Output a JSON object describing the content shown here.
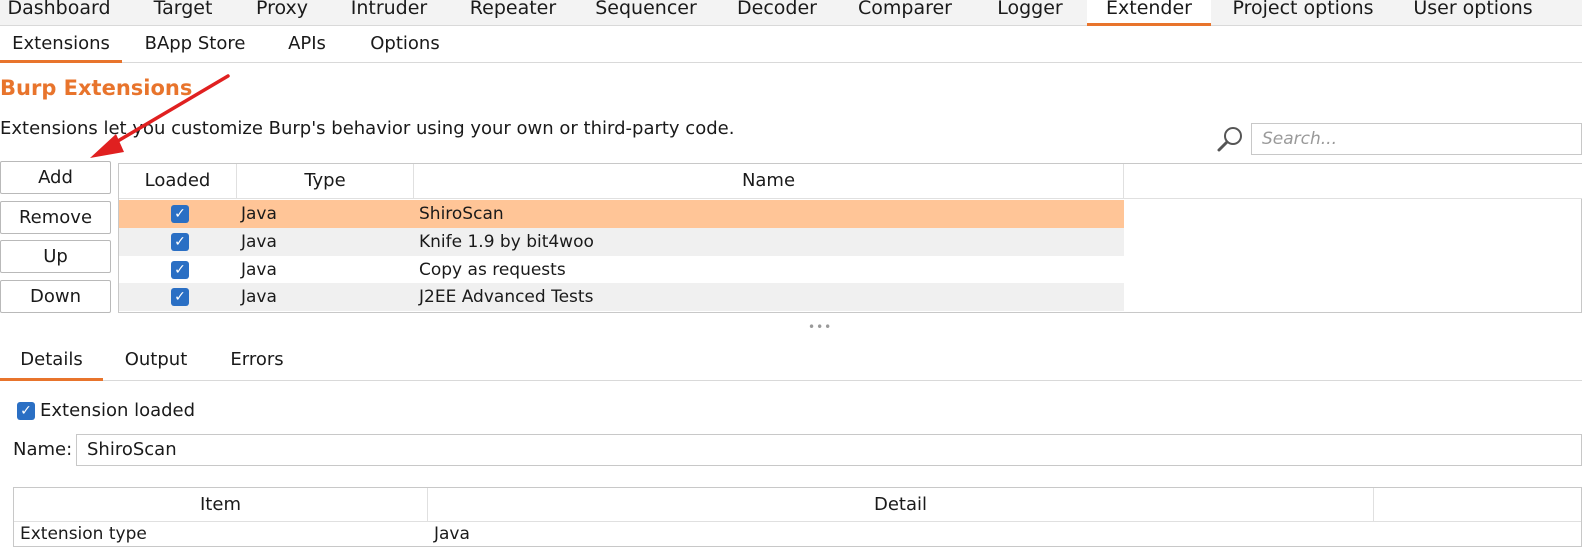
{
  "top_tabs": [
    "Dashboard",
    "Target",
    "Proxy",
    "Intruder",
    "Repeater",
    "Sequencer",
    "Decoder",
    "Comparer",
    "Logger",
    "Extender",
    "Project options",
    "User options"
  ],
  "top_tabs_active": "Extender",
  "sub_tabs": [
    "Extensions",
    "BApp Store",
    "APIs",
    "Options"
  ],
  "sub_tabs_active": "Extensions",
  "section": {
    "title": "Burp Extensions",
    "description": "Extensions let you customize Burp's behavior using your own or third-party code."
  },
  "search": {
    "placeholder": "Search...",
    "icon": "magnifier-icon"
  },
  "buttons": {
    "add": "Add",
    "remove": "Remove",
    "up": "Up",
    "down": "Down"
  },
  "extensions_table": {
    "columns": [
      "Loaded",
      "Type",
      "Name"
    ],
    "rows": [
      {
        "loaded": true,
        "type": "Java",
        "name": "ShiroScan",
        "selected": true
      },
      {
        "loaded": true,
        "type": "Java",
        "name": "Knife 1.9 by bit4woo",
        "selected": false
      },
      {
        "loaded": true,
        "type": "Java",
        "name": "Copy as requests",
        "selected": false
      },
      {
        "loaded": true,
        "type": "Java",
        "name": "J2EE Advanced Tests",
        "selected": false
      }
    ]
  },
  "lower_tabs": [
    "Details",
    "Output",
    "Errors"
  ],
  "lower_tabs_active": "Details",
  "details": {
    "extension_loaded_label": "Extension loaded",
    "extension_loaded": true,
    "name_label": "Name:",
    "name_value": "ShiroScan",
    "table_columns": [
      "Item",
      "Detail"
    ],
    "first_row": {
      "item": "Extension type",
      "detail": "Java"
    }
  },
  "colors": {
    "accent": "#e8742c",
    "selected_row": "#ffc597",
    "checkbox": "#2a6fc4",
    "annotation_arrow": "#e02020"
  }
}
